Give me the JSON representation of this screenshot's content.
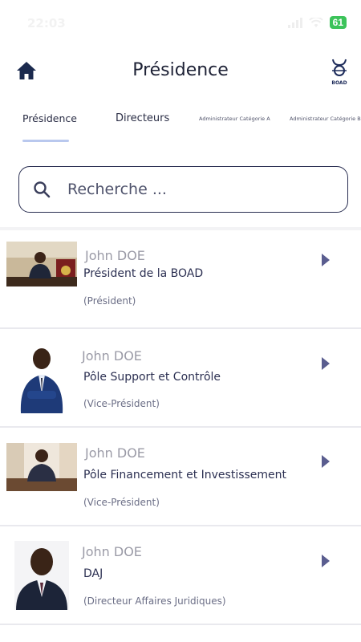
{
  "status_bar": {
    "time": "22:03",
    "battery": "61"
  },
  "header": {
    "title": "Présidence",
    "logo_text": "BOAD"
  },
  "tabs": [
    {
      "label": "Présidence",
      "active": true
    },
    {
      "label": "Directeurs",
      "active": false
    },
    {
      "label": "Administrateur Catégorie A",
      "active": false
    },
    {
      "label": "Administrateur Catégorie B",
      "active": false
    }
  ],
  "search": {
    "placeholder": "Recherche ..."
  },
  "people": [
    {
      "name": "John DOE",
      "title": "Président de la BOAD",
      "role": "(Président)"
    },
    {
      "name": "John DOE",
      "title": "Pôle Support et Contrôle",
      "role": "(Vice-Président)"
    },
    {
      "name": "John DOE",
      "title": "Pôle Financement et Investissement",
      "role": "(Vice-Président)"
    },
    {
      "name": "John DOE",
      "title": "DAJ",
      "role": "(Directeur Affaires Juridiques)"
    }
  ],
  "colors": {
    "accent": "#5a5d8f",
    "tab_underline": "#b9c8ee",
    "text_dark": "#1e2236"
  }
}
